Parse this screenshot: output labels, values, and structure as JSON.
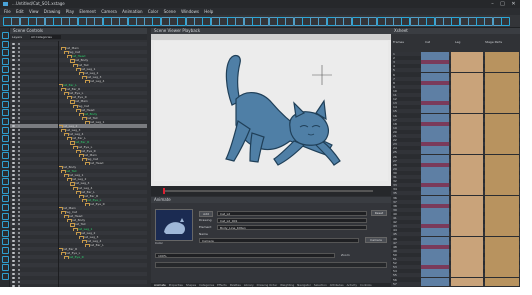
{
  "window": {
    "title": "...Untitled/Cat_SO1.xstage",
    "controls": {
      "minimize": "–",
      "maximize": "□",
      "close": "✕"
    }
  },
  "menu": [
    "File",
    "Edit",
    "View",
    "Drawing",
    "Play",
    "Element",
    "Camera",
    "Animation",
    "Color",
    "Scene",
    "Windows",
    "Help"
  ],
  "timeline": {
    "title": "Scene Controls",
    "tab_label": "All Categories",
    "filter_label": "Layers",
    "node_labels": [
      "Cat_Main",
      "Peg_Cat",
      "Cat_Head",
      "Cat_Body",
      "Cat_Tail",
      "Cat_Leg_1",
      "Cat_Leg_2",
      "Cat_Leg_3",
      "Cat_Leg_4",
      "Cat_Ear_L",
      "Cat_Ear_R",
      "Cat_Eye_L",
      "Cat_Eye_R"
    ]
  },
  "viewer": {
    "title": "Scene Viewer  Playback"
  },
  "properties": {
    "title": "Animate",
    "name_label": "Name",
    "name_value": "Cat_L2",
    "element_label": "Element",
    "element_value": "Body_Line_Kitten",
    "drawing_label": "Drawing",
    "drawing_value": "Cat_L2_001",
    "camera_label": "Camera",
    "camera_value": "Camera",
    "zoom_label": "Zoom",
    "zoom_value": "100%",
    "add_button": "Add",
    "reset_button": "Reset",
    "color_label": "Color"
  },
  "tabs": [
    "Animate",
    "Properties",
    "Shapes",
    "Categories",
    "Effects",
    "Palettes",
    "Library",
    "Drawing Order",
    "Weighting",
    "Navigator",
    "Selection",
    "Attributes",
    "Activity",
    "Controls"
  ],
  "xsheet": {
    "title": "Xsheet",
    "columns": [
      "Frames",
      "Cat",
      "Leg",
      "Stage Parts"
    ],
    "frames": [
      "1",
      "2",
      "3",
      "4",
      "5",
      "6",
      "7",
      "8",
      "9",
      "10",
      "11",
      "12",
      "13",
      "14",
      "15",
      "16",
      "17",
      "18",
      "19",
      "20",
      "21",
      "22",
      "23",
      "24",
      "25",
      "26",
      "27",
      "28",
      "29",
      "30",
      "31",
      "32",
      "33",
      "34",
      "35",
      "36",
      "37",
      "38",
      "39",
      "40",
      "41",
      "42",
      "43",
      "44",
      "45",
      "46",
      "47",
      "48",
      "49",
      "50",
      "51",
      "52",
      "53",
      "54",
      "55",
      "56",
      "57"
    ]
  },
  "colors": {
    "accent": "#2aa7d8",
    "cat_body": "#4f7fa6",
    "cat_outline": "#1f3f58",
    "xsheet_fill": "#c9a37a"
  }
}
